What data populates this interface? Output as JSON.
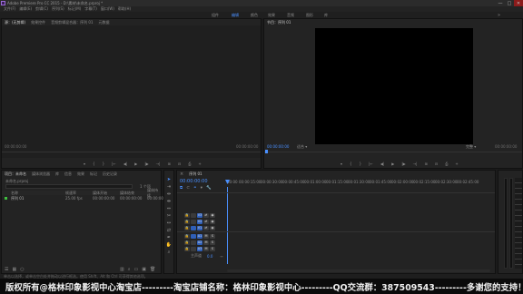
{
  "titlebar": {
    "title": "Adobe Premiere Pro CC 2015 - D:\\素材\\未命名.prproj *"
  },
  "window_controls": {
    "minimize": "—",
    "maximize": "□",
    "close": "✕"
  },
  "menu": [
    "文件(F)",
    "编辑(E)",
    "剪辑(C)",
    "序列(S)",
    "标记(M)",
    "字幕(T)",
    "窗口(W)",
    "帮助(H)"
  ],
  "workspaces": {
    "items": [
      "组件",
      "编辑",
      "颜色",
      "效果",
      "音频",
      "图形",
      "库"
    ],
    "active_index": 1
  },
  "source_panel": {
    "tabs": [
      "源：(无剪辑)",
      "效果控件",
      "音频剪辑混合器：序列 01",
      "元数据"
    ],
    "tc_left": "00:00:00:00",
    "tc_right": "00:00:00:00",
    "controls": [
      "▾",
      "{",
      "}",
      "|←",
      "◀|",
      "▶",
      "|▶",
      "→|",
      "⊞",
      "⊟",
      "⎙",
      "+"
    ]
  },
  "program_panel": {
    "tab": "节目：序列 01",
    "tc_left": "00:00:00:00",
    "fit": "适合",
    "tc_right": "00:00:00:00",
    "full": "完整",
    "controls": [
      "▾",
      "{",
      "}",
      "|←",
      "◀|",
      "▶",
      "|▶",
      "→|",
      "⊞",
      "⊟",
      "⎙",
      "+"
    ]
  },
  "project_panel": {
    "tabs": [
      "项目：未命名",
      "媒体浏览器",
      "库",
      "信息",
      "效果",
      "标记",
      "历史记录"
    ],
    "project_file": "未命名.prproj",
    "item_count": "1 个项",
    "columns": [
      "名称",
      "帧速率",
      "媒体开始",
      "媒体结束",
      "媒体持续"
    ],
    "items": [
      {
        "name": "序列 01",
        "fps": "25.00 fps",
        "start": "00:00:00:00",
        "end": "00:00:00:00",
        "dur": "00:00:00:00"
      }
    ]
  },
  "timeline": {
    "tab": "序列 01",
    "tc": "00:00:00:00",
    "ruler": [
      "00:00",
      "00:00:15:00",
      "00:00:30:00",
      "00:00:45:00",
      "00:01:00:00",
      "00:01:15:00",
      "00:01:30:00",
      "00:01:45:00",
      "00:02:00:00",
      "00:02:15:00",
      "00:02:30:00",
      "00:02:45:00"
    ],
    "video_tracks": [
      "V3",
      "V2",
      "V1"
    ],
    "audio_tracks": [
      "A1",
      "A2",
      "A3"
    ],
    "master": "主声道",
    "master_val": "0.0"
  },
  "status": {
    "text": "单击以选择，或单击空白处并拖动以进行框选。使用 Shift、Alt 和 Ctrl 可获得其他选项。"
  },
  "banner": {
    "text": "版权所有@格林印象影视中心淘宝店---------淘宝店铺名称：格林印象影视中心---------QQ交流群：387509543---------多谢您的支持！"
  },
  "colors": {
    "accent": "#4a90ff",
    "track_active": "#2f5fb8",
    "panel": "#232323"
  }
}
